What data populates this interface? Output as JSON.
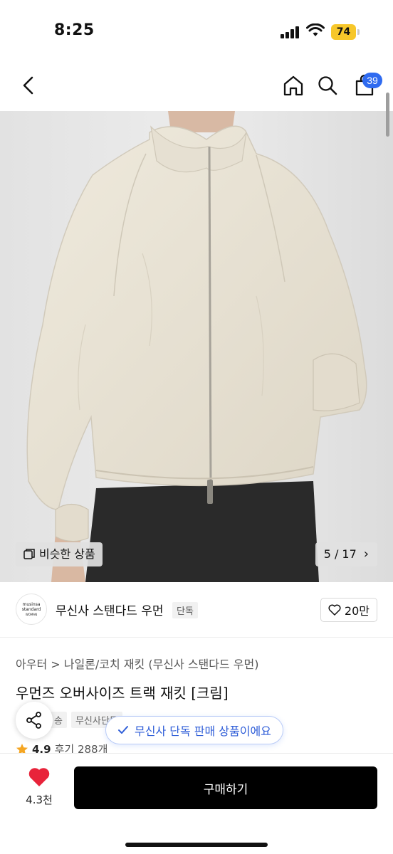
{
  "status_bar": {
    "time": "8:25",
    "battery": "74"
  },
  "header": {
    "cart_count": "39",
    "back_icon": "chevron-left-icon",
    "home_icon": "home-icon",
    "search_icon": "search-icon",
    "cart_icon": "cart-icon"
  },
  "gallery": {
    "similar_label": "비슷한 상품",
    "page_indicator": "5 / 17",
    "chevron": "›"
  },
  "brand": {
    "logo_line1": "musinsa",
    "logo_line2": "standard",
    "logo_line3": "WOMAN",
    "name": "무신사 스탠다드 우먼",
    "tag": "단독",
    "likes": "20만"
  },
  "product": {
    "breadcrumb": "아우터  >  나일론/코치 재킷  (무신사 스탠다드 우먼)",
    "title": "우먼즈 오버사이즈 트랙 재킷 [크림]",
    "tags": [
      "송",
      "무신사단독"
    ],
    "rating": "4.9",
    "reviews": "후기 288개"
  },
  "toast": {
    "text": "무신사 단독 판매 상품이에요"
  },
  "bottom_bar": {
    "wish_count": "4.3천",
    "buy_label": "구매하기"
  },
  "colors": {
    "accent_blue": "#2f6bf0",
    "heart_red": "#e8233a",
    "battery_yellow": "#f7c72a",
    "star": "#f5a623"
  }
}
